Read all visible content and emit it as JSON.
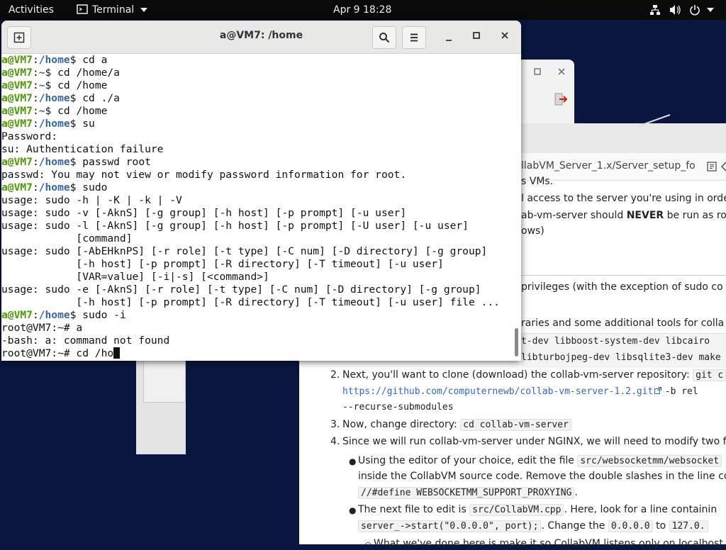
{
  "topbar": {
    "activities": "Activities",
    "app_name": "Terminal",
    "clock": "Apr 9  18:28"
  },
  "icons": {
    "network": "network-icon",
    "volume": "volume-icon",
    "power": "power-icon",
    "app_menu_arrow": "chevron-down-icon",
    "new_tab": "new-tab-icon",
    "search": "search-icon",
    "menu": "hamburger-menu-icon",
    "minimize": "minimize-icon",
    "maximize": "maximize-icon",
    "close": "close-icon"
  },
  "terminal": {
    "title": "a@VM7: /home",
    "lines": [
      {
        "prompt_user": "a@VM7",
        "prompt_path": "/home",
        "prompt_end": "$ ",
        "text": "cd a"
      },
      {
        "prompt_user": "a@VM7",
        "prompt_path": "~",
        "prompt_end": "$ ",
        "text": "cd /home/a"
      },
      {
        "prompt_user": "a@VM7",
        "prompt_path": "~",
        "prompt_end": "$ ",
        "text": "cd /home"
      },
      {
        "prompt_user": "a@VM7",
        "prompt_path": "/home",
        "prompt_end": "$ ",
        "text": "cd ./a"
      },
      {
        "prompt_user": "a@VM7",
        "prompt_path": "~",
        "prompt_end": "$ ",
        "text": "cd /home"
      },
      {
        "prompt_user": "a@VM7",
        "prompt_path": "/home",
        "prompt_end": "$ ",
        "text": "su"
      },
      {
        "text": "Password:"
      },
      {
        "text": "su: Authentication failure"
      },
      {
        "prompt_user": "a@VM7",
        "prompt_path": "/home",
        "prompt_end": "$ ",
        "text": "passwd root"
      },
      {
        "text": "passwd: You may not view or modify password information for root."
      },
      {
        "prompt_user": "a@VM7",
        "prompt_path": "/home",
        "prompt_end": "$ ",
        "text": "sudo"
      },
      {
        "text": "usage: sudo -h | -K | -k | -V"
      },
      {
        "text": "usage: sudo -v [-AknS] [-g group] [-h host] [-p prompt] [-u user]"
      },
      {
        "text": "usage: sudo -l [-AknS] [-g group] [-h host] [-p prompt] [-U user] [-u user]"
      },
      {
        "text": "            [command]"
      },
      {
        "text": "usage: sudo [-AbEHknPS] [-r role] [-t type] [-C num] [-D directory] [-g group]"
      },
      {
        "text": "            [-h host] [-p prompt] [-R directory] [-T timeout] [-u user]"
      },
      {
        "text": "            [VAR=value] [-i|-s] [<command>]"
      },
      {
        "text": "usage: sudo -e [-AknS] [-r role] [-t type] [-C num] [-D directory] [-g group]"
      },
      {
        "text": "            [-h host] [-p prompt] [-R directory] [-T timeout] [-u user] file ..."
      },
      {
        "prompt_user": "a@VM7",
        "prompt_path": "/home",
        "prompt_end": "$ ",
        "text": "sudo -i"
      },
      {
        "text": "root@VM7:~# a"
      },
      {
        "text": "-bash: a: command not found"
      },
      {
        "text": "root@VM7:~# cd /ho",
        "cursor": true
      }
    ]
  },
  "browser": {
    "url": "llabVM_Server_1.x/Server_setup_fo",
    "lines": {
      "l1": "s VMs.",
      "l2": "l access to the server you're using in orde",
      "l3_a": "ab-vm-server should ",
      "l3_b": "NEVER",
      "l3_c": " be run as ro",
      "l4": "ows)",
      "l5": "privileges (with the exception of sudo co",
      "l6": "raries and some additional tools for colla",
      "l7": "t-dev libboost-system-dev libcairo",
      "l8": "libturbojpeg-dev libsqlite3-dev make",
      "step2_num": "2.",
      "step2_text": "Next, you'll want to clone (download) the collab-vm-server repository:",
      "step2_code": "git c",
      "step2_link": "https://github.com/computernewb/collab-vm-server-1.2.git",
      "step2_flag": "-b rel",
      "step2_flag2": "--recurse-submodules",
      "step3_num": "3.",
      "step3_text": "Now, change directory:",
      "step3_code": "cd collab-vm-server",
      "step4_num": "4.",
      "step4_text": "Since we will run collab-vm-server under NGINX, we will need to modify two f",
      "b1_text": "Using the editor of your choice, edit the file",
      "b1_code": "src/websocketmm/websocket",
      "b1_line2": "inside the CollabVM source code. Remove the double slashes in the line co",
      "b1_code2": "//#define WEBSOCKETMM_SUPPORT_PROXYING",
      "b1_dot": ".",
      "b2_text": "The next file to edit is",
      "b2_code": "src/CollabVM.cpp",
      "b2_rest": ". Here, look for a line containin",
      "b2_code2": "server_->start(\"0.0.0.0\", port);",
      "b2_change": ". Change the",
      "b2_code3": "0.0.0.0",
      "b2_to": "to",
      "b2_code4": "127.0.",
      "b3_text": "What we've done here is make it so CollabVM listens only on localhost"
    }
  }
}
